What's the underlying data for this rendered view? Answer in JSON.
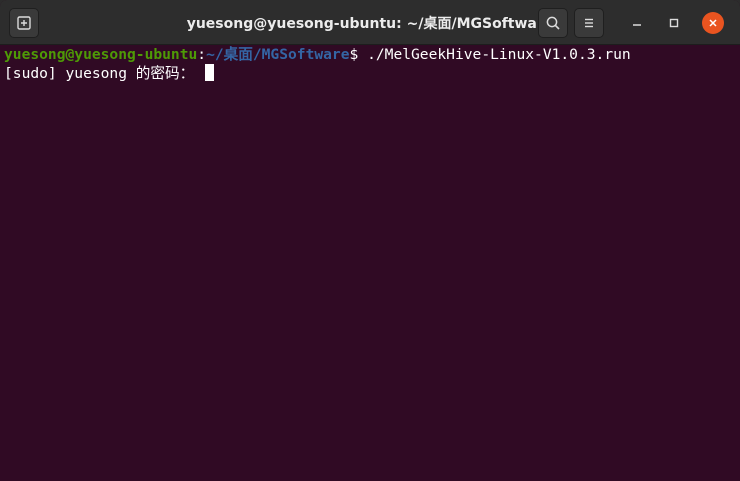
{
  "window": {
    "title": "yuesong@yuesong-ubuntu: ~/桌面/MGSoftware"
  },
  "titlebar": {
    "new_tab_icon": "new-tab-icon",
    "search_icon": "search-icon",
    "menu_icon": "hamburger-menu-icon",
    "minimize_icon": "minimize-icon",
    "maximize_icon": "maximize-icon",
    "close_icon": "close-icon"
  },
  "terminal": {
    "prompt_user_host": "yuesong@yuesong-ubuntu",
    "prompt_colon": ":",
    "prompt_path": "~/桌面/MGSoftware",
    "prompt_symbol": "$ ",
    "command": "./MelGeekHive-Linux-V1.0.3.run",
    "sudo_prompt": "[sudo] yuesong 的密码： "
  },
  "colors": {
    "terminal_bg": "#300a24",
    "titlebar_bg": "#2d2d2d",
    "prompt_green": "#4e9a06",
    "prompt_blue": "#3465a4",
    "close_orange": "#e95420"
  }
}
